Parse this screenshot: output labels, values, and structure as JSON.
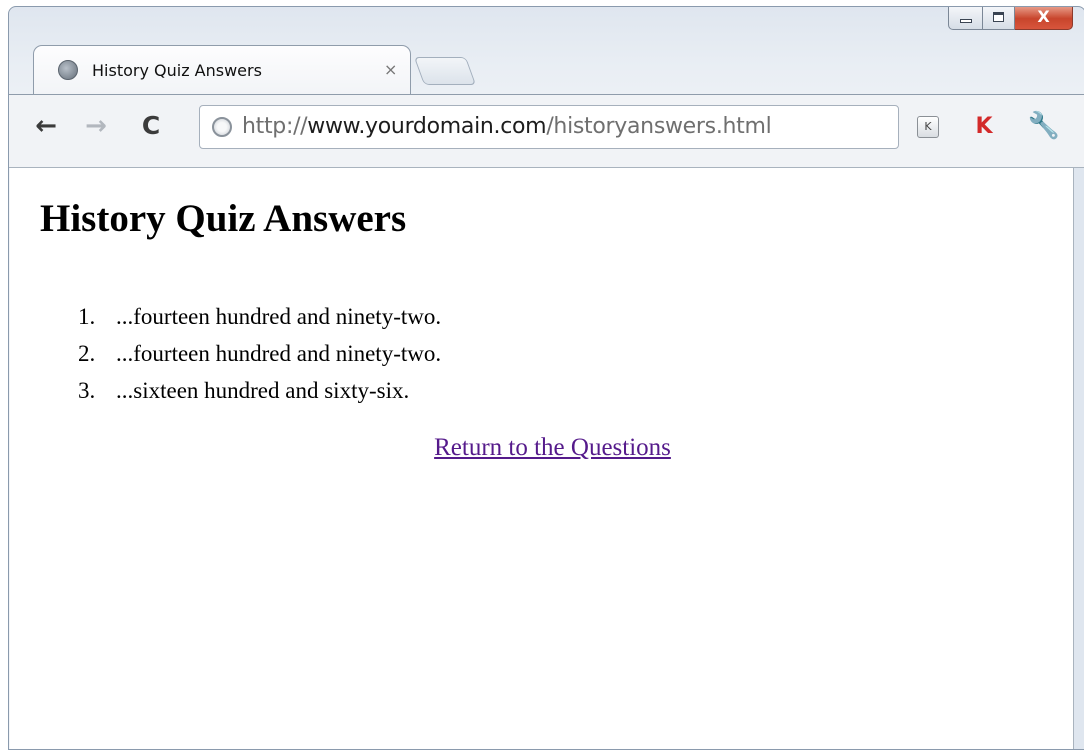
{
  "window_controls": {
    "minimize_icon": "minimize-icon",
    "maximize_icon": "maximize-icon",
    "close_icon": "close-icon",
    "close_glyph": "X"
  },
  "tab": {
    "title": "History Quiz Answers",
    "close_glyph": "×",
    "favicon": "globe-icon"
  },
  "toolbar": {
    "back_glyph": "←",
    "forward_glyph": "→",
    "reload_glyph": "C",
    "url_scheme": "http://",
    "url_domain": "www.yourdomain.com",
    "url_path": "/historyanswers.html",
    "ext_k_label": "K",
    "ext_kav_glyph": "K",
    "wrench_glyph": "🔧"
  },
  "page": {
    "heading": "History Quiz Answers",
    "answers": [
      {
        "number": "1.",
        "text": "...fourteen hundred and ninety-two."
      },
      {
        "number": "2.",
        "text": "...fourteen hundred and ninety-two."
      },
      {
        "number": "3.",
        "text": "...sixteen hundred and sixty-six."
      }
    ],
    "return_link": "Return to the Questions"
  },
  "colors": {
    "visited_link": "#551a8b",
    "close_button": "#c8452c"
  }
}
